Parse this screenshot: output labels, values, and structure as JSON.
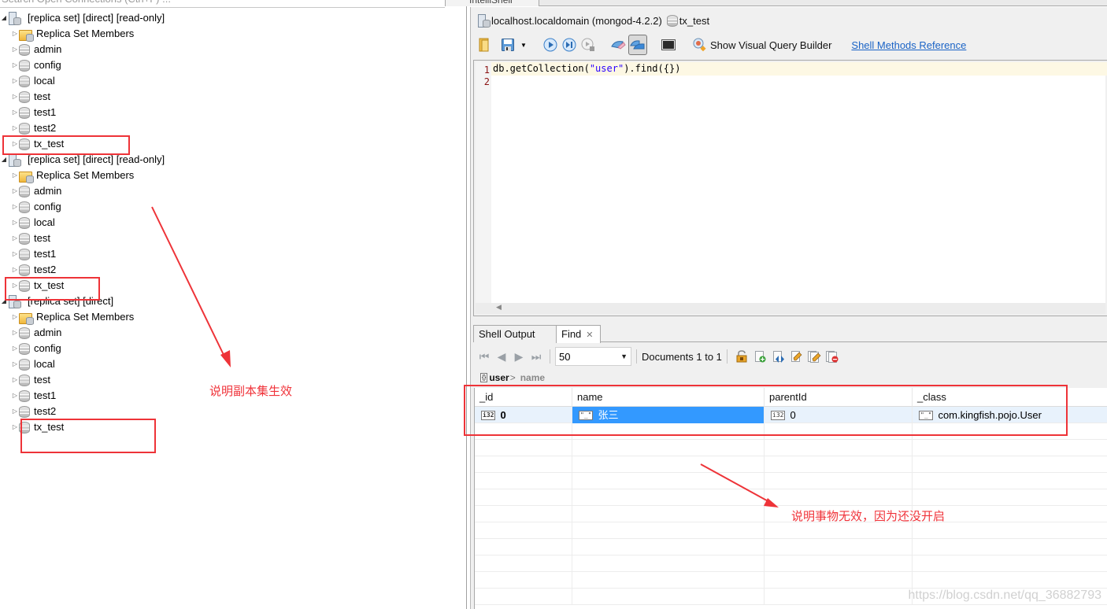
{
  "left_tree": {
    "search_placeholder": "Search Open Connections (Ctrl+F) ...",
    "connections": [
      {
        "label": "[replica set] [direct] [read-only]",
        "children": [
          "Replica Set Members",
          "admin",
          "config",
          "local",
          "test",
          "test1",
          "test2",
          "tx_test"
        ]
      },
      {
        "label": "[replica set] [direct] [read-only]",
        "children": [
          "Replica Set Members",
          "admin",
          "config",
          "local",
          "test",
          "test1",
          "test2",
          "tx_test"
        ]
      },
      {
        "label": "[replica set] [direct]",
        "children": [
          "Replica Set Members",
          "admin",
          "config",
          "local",
          "test",
          "test1",
          "test2",
          "tx_test"
        ]
      }
    ]
  },
  "annotations": {
    "replica_note": "说明副本集生效",
    "transaction_note": "说明事物无效，因为还没开启"
  },
  "editor_tab": {
    "label": "IntelliShell"
  },
  "connection_crumb": {
    "server": "localhost.localdomain (mongod-4.2.2)",
    "database": "tx_test"
  },
  "toolbar": {
    "icons": [
      "open-folder-icon",
      "save-icon",
      "dropdown-icon",
      "execute-all-icon",
      "execute-current-icon",
      "explain-icon",
      "clear-icon",
      "toggle-query-icon",
      "terminal-icon"
    ],
    "visual_query_builder": "Show Visual Query Builder",
    "shell_reference_link": "Shell Methods Reference"
  },
  "editor": {
    "lines": [
      {
        "num": "1",
        "prefix": "db.getCollection(",
        "string": "\"user\"",
        "suffix": ").find({})"
      },
      {
        "num": "2",
        "prefix": "",
        "string": "",
        "suffix": ""
      }
    ]
  },
  "result_tabs": [
    {
      "label": "Shell Output",
      "active": false
    },
    {
      "label": "Find",
      "active": true,
      "closable": true
    }
  ],
  "find_toolbar": {
    "page_size": "50",
    "documents_label": "Documents 1 to 1"
  },
  "path_bar": {
    "collection": "user",
    "separator": ">",
    "field": "name"
  },
  "grid": {
    "columns": [
      "_id",
      "name",
      "parentId",
      "_class"
    ],
    "rows": [
      {
        "_id": {
          "type": "i32",
          "value": "0"
        },
        "name": {
          "type": "\"_\"",
          "value": "张三"
        },
        "parentId": {
          "type": "i32",
          "value": "0"
        },
        "_class": {
          "type": "\"_\"",
          "value": "com.kingfish.pojo.User"
        }
      }
    ]
  },
  "watermark": "https://blog.csdn.net/qq_36882793",
  "colors": {
    "annotation_red": "#ee3338",
    "selection_blue": "#3399ff",
    "link_blue": "#1a63c6"
  }
}
